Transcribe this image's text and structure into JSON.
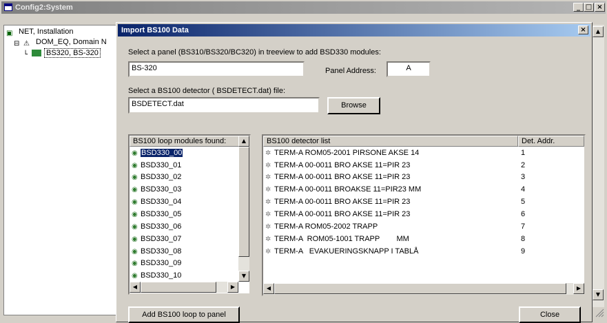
{
  "window": {
    "title": "Config2:System",
    "controls": {
      "minimize": "_",
      "maximize": "□",
      "close": "×"
    }
  },
  "tree": {
    "items": [
      {
        "label": "NET, Installation",
        "icon": "network-icon"
      },
      {
        "label": "DOM_EQ, Domain N",
        "icon": "domain-icon"
      },
      {
        "label": "BS320, BS-320",
        "icon": "panel-icon",
        "selected": true
      }
    ]
  },
  "dialog": {
    "title": "Import BS100 Data",
    "close": "×",
    "panel_prompt": "Select a panel (BS310/BS320/BC320) in treeview to add BSD330 modules:",
    "panel_value": "BS-320",
    "panel_address_label": "Panel Address:",
    "panel_address_value": "A",
    "file_prompt": "Select a BS100 detector ( BSDETECT.dat) file:",
    "file_value": "BSDETECT.dat",
    "browse_label": "Browse",
    "modules": {
      "header": "BS100 loop modules found:",
      "items": [
        "BSD330_00",
        "BSD330_01",
        "BSD330_02",
        "BSD330_03",
        "BSD330_04",
        "BSD330_05",
        "BSD330_06",
        "BSD330_07",
        "BSD330_08",
        "BSD330_09",
        "BSD330_10"
      ]
    },
    "detectors": {
      "headers": [
        "BS100 detector list",
        "Det. Addr."
      ],
      "rows": [
        {
          "name": "TERM-A ROM05-2001 PIRSONE AKSE 14",
          "addr": "1"
        },
        {
          "name": "TERM-A 00-0011 BRO AKSE 11=PIR 23",
          "addr": "2"
        },
        {
          "name": "TERM-A 00-0011 BRO AKSE 11=PIR 23",
          "addr": "3"
        },
        {
          "name": "TERM-A 00-0011 BROAKSE 11=PIR23 MM",
          "addr": "4"
        },
        {
          "name": "TERM-A 00-0011 BRO AKSE 11=PIR 23",
          "addr": "5"
        },
        {
          "name": "TERM-A 00-0011 BRO AKSE 11=PIR 23",
          "addr": "6"
        },
        {
          "name": "TERM-A ROM05-2002 TRAPP",
          "addr": "7"
        },
        {
          "name": "TERM-A  ROM05-1001 TRAPP        MM",
          "addr": "8"
        },
        {
          "name": "TERM-A   EVAKUERINGSKNAPP I TABLÅ",
          "addr": "9"
        }
      ]
    },
    "add_button": "Add BS100 loop to panel",
    "close_button": "Close"
  },
  "icons": {
    "module_icon": "loop-module-icon",
    "detector_icon": "detector-icon"
  }
}
